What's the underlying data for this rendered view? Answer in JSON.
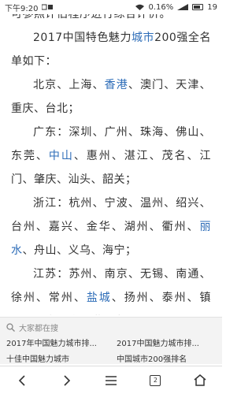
{
  "status_bar": {
    "time": "下午9:20",
    "battery_percent": "0.16%",
    "battery_level": "19"
  },
  "article": {
    "top_cut_line": "可参照评估程序进行综合评价。",
    "intro_prefix": "2017中国特色魅力",
    "intro_link": "城市",
    "intro_suffix": "200强全名单如下：",
    "group_1_a": "北京、上海、",
    "group_1_link": "香港",
    "group_1_b": "、澳门、天津、重庆、台北；",
    "group_2_a": "广东：深圳、广州、珠海、佛山、东莞、",
    "group_2_link": "中山",
    "group_2_b": "、惠州、湛江、茂名、江门、肇庆、汕头、韶关；",
    "group_3_a": "浙江：杭州、宁波、温州、绍兴、台州、嘉兴、金华、湖州、衢州、",
    "group_3_link": "丽水",
    "group_3_b": "、舟山、义乌、海宁；",
    "group_4_a": "江苏：苏州、南京、无锡、南通、徐州、常州、",
    "group_4_link": "盐城",
    "group_4_b": "、扬州、泰州、镇江、淮安、连云港、宿迁；"
  },
  "related": {
    "header": "大家都在搜",
    "items": [
      "2017年中国魅力城市排...",
      "2017中国魅力城市排...",
      "十佳中国魅力城市",
      "中国城市200强排名"
    ]
  },
  "bottom_nav": {
    "tab_count": "2"
  },
  "colors": {
    "link": "#2e6db8",
    "text": "#333333",
    "related_bg": "#f3f3f3"
  }
}
